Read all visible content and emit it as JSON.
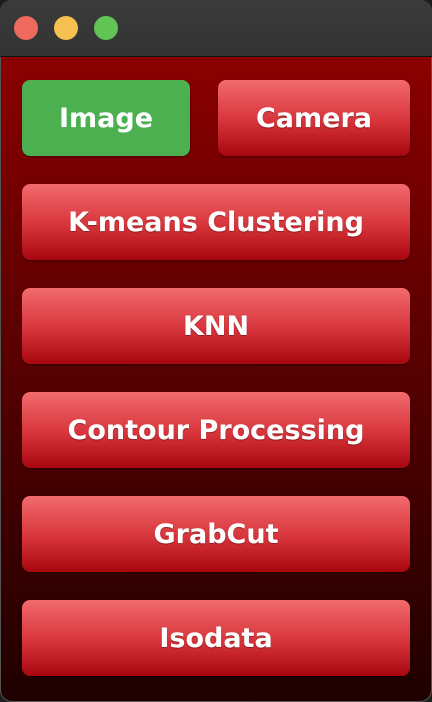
{
  "window": {
    "controls": [
      "close",
      "minimize",
      "maximize"
    ]
  },
  "buttons": {
    "image": "Image",
    "camera": "Camera",
    "kmeans": "K-means Clustering",
    "knn": "KNN",
    "contour": "Contour Processing",
    "grabcut": "GrabCut",
    "isodata": "Isodata"
  },
  "colors": {
    "active_button": "#4cb050",
    "button_top": "#f26b6e",
    "button_bottom": "#a8060f",
    "background_top": "#8b0000",
    "background_bottom": "#1f0000"
  }
}
